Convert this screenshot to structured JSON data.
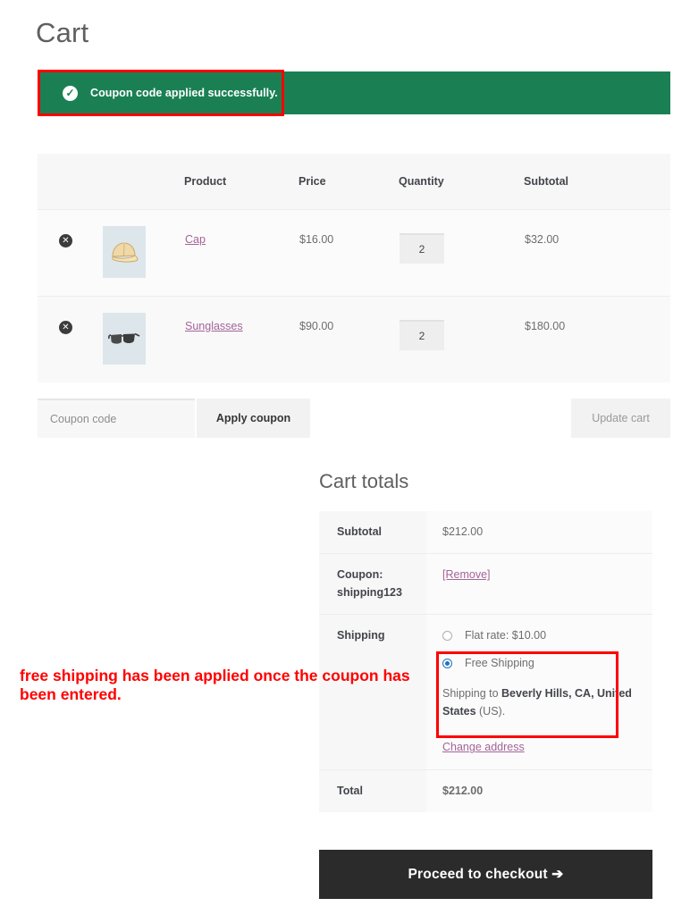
{
  "page": {
    "title": "Cart"
  },
  "notice": {
    "icon": "check-circle-icon",
    "message": "Coupon code applied successfully."
  },
  "annotation": {
    "text": "free shipping has been applied once the coupon has been entered.",
    "color": "#ff0000"
  },
  "cart_table": {
    "headers": {
      "remove": "",
      "thumbnail": "",
      "product": "Product",
      "price": "Price",
      "quantity": "Quantity",
      "subtotal": "Subtotal"
    },
    "rows": [
      {
        "remove_icon": "remove-item-icon",
        "thumbnail": "cap-thumbnail",
        "product": "Cap",
        "price": "$16.00",
        "quantity": "2",
        "subtotal": "$32.00"
      },
      {
        "remove_icon": "remove-item-icon",
        "thumbnail": "sunglasses-thumbnail",
        "product": "Sunglasses",
        "price": "$90.00",
        "quantity": "2",
        "subtotal": "$180.00"
      }
    ]
  },
  "coupon": {
    "placeholder": "Coupon code",
    "value": "",
    "apply_label": "Apply coupon",
    "update_label": "Update cart"
  },
  "totals": {
    "title": "Cart totals",
    "subtotal_label": "Subtotal",
    "subtotal_value": "$212.00",
    "coupon_label": "Coupon: shipping123",
    "coupon_remove": "[Remove]",
    "shipping_label": "Shipping",
    "shipping_options": [
      {
        "label": "Flat rate: $10.00",
        "selected": false
      },
      {
        "label": "Free Shipping",
        "selected": true
      }
    ],
    "shipping_to_prefix": "Shipping to ",
    "shipping_to_address": "Beverly Hills, CA, United States",
    "shipping_to_suffix": " (US).",
    "change_address": "Change address",
    "total_label": "Total",
    "total_value": "$212.00"
  },
  "checkout": {
    "label": "Proceed to checkout  ➔"
  },
  "colors": {
    "success_green": "#1a8054",
    "annotation_red": "#ff0000",
    "link_purple": "#a46497",
    "radio_blue": "#1e73be",
    "checkout_dark": "#2b2b2b"
  }
}
